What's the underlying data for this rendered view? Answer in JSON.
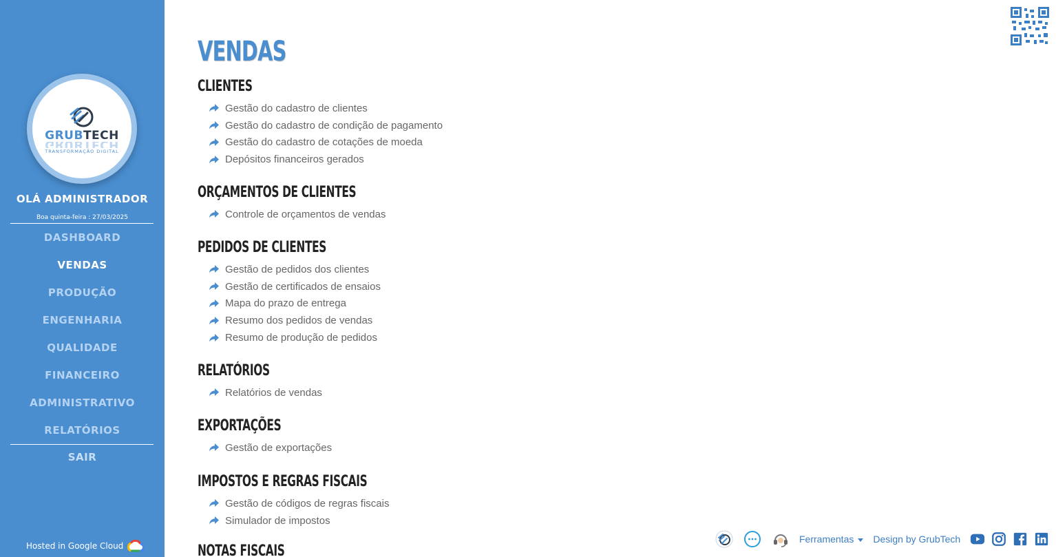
{
  "sidebar": {
    "logo": {
      "brand_part1": "GRUB",
      "brand_part2": "TECH",
      "tagline": "TRANSFORMAÇÃO DIGITAL"
    },
    "greeting": "OLÁ ADMINISTRADOR",
    "date_line": "Boa quinta-feira : 27/03/2025",
    "nav": [
      {
        "label": "DASHBOARD",
        "active": false
      },
      {
        "label": "VENDAS",
        "active": true
      },
      {
        "label": "PRODUÇÃO",
        "active": false
      },
      {
        "label": "ENGENHARIA",
        "active": false
      },
      {
        "label": "QUALIDADE",
        "active": false
      },
      {
        "label": "FINANCEIRO",
        "active": false
      },
      {
        "label": "ADMINISTRATIVO",
        "active": false
      },
      {
        "label": "RELATÓRIOS",
        "active": false
      }
    ],
    "logout": "SAIR",
    "hosted": "Hosted in Google Cloud"
  },
  "main": {
    "title": "VENDAS",
    "sections": [
      {
        "title": "CLIENTES",
        "links": [
          "Gestão do cadastro de clientes",
          "Gestão do cadastro de condição de pagamento",
          "Gestão do cadastro de cotações de moeda",
          "Depósitos financeiros gerados"
        ]
      },
      {
        "title": "ORÇAMENTOS DE CLIENTES",
        "links": [
          "Controle de orçamentos de vendas"
        ]
      },
      {
        "title": "PEDIDOS DE CLIENTES",
        "links": [
          "Gestão de pedidos dos clientes",
          "Gestão de certificados de ensaios",
          "Mapa do prazo de entrega",
          "Resumo dos pedidos de vendas",
          "Resumo de produção de pedidos"
        ]
      },
      {
        "title": "RELATÓRIOS",
        "links": [
          "Relatórios de vendas"
        ]
      },
      {
        "title": "EXPORTAÇÕES",
        "links": [
          "Gestão de exportações"
        ]
      },
      {
        "title": "IMPOSTOS E REGRAS FISCAIS",
        "links": [
          "Gestão de códigos de regras fiscais",
          "Simulador de impostos"
        ]
      },
      {
        "title": "NOTAS FISCAIS",
        "links": []
      }
    ]
  },
  "footer": {
    "tools_label": "Ferramentas",
    "design_label": "Design by GrubTech",
    "icons": [
      "grubtech-logo-icon",
      "chat-icon",
      "support-headset-icon"
    ],
    "social": [
      "youtube-icon",
      "instagram-icon",
      "facebook-icon",
      "linkedin-icon"
    ]
  },
  "colors": {
    "sidebar": "#4a8ed0",
    "accent": "#4a8ed0",
    "nav_inactive": "#b4d3f2",
    "link_text": "#666666"
  }
}
